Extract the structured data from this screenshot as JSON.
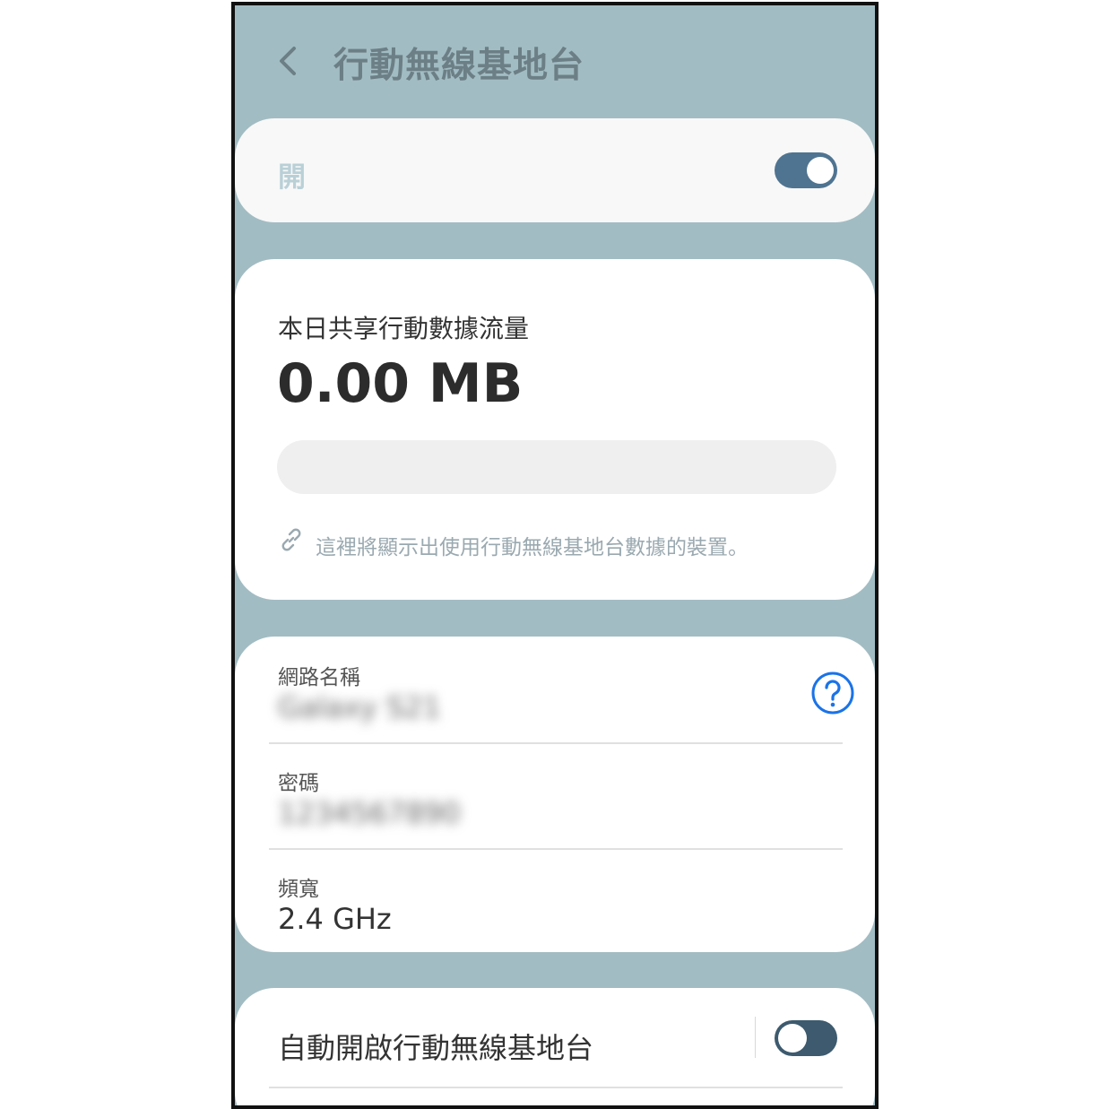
{
  "header": {
    "title": "行動無線基地台",
    "back_icon": "chevron-left-icon"
  },
  "master_switch": {
    "label": "開",
    "state": "on"
  },
  "usage": {
    "label": "本日共享行動數據流量",
    "value": "0.00 MB",
    "progress_fraction": 0,
    "hint": "這裡將顯示出使用行動無線基地台數據的裝置。",
    "hint_icon": "link-icon"
  },
  "network": {
    "name_label": "網路名稱",
    "name_value": "Galaxy S21",
    "password_label": "密碼",
    "password_value": "1234567890",
    "band_label": "頻寬",
    "band_value": "2.4 GHz",
    "help_icon": "help-icon"
  },
  "auto_hotspot": {
    "label": "自動開啟行動無線基地台",
    "state": "off"
  },
  "colors": {
    "background": "#a2bcc3",
    "toggle_on": "#4f7491",
    "toggle_off": "#3d5a6e",
    "help_blue": "#1a73e8"
  }
}
